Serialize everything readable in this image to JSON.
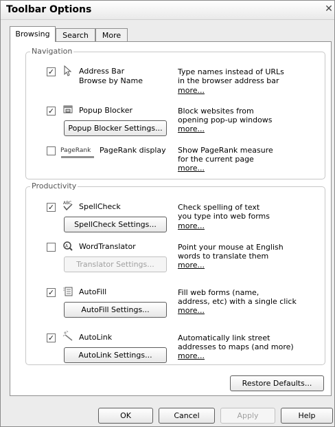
{
  "window": {
    "title": "Toolbar Options",
    "close_glyph": "✕"
  },
  "tabs": [
    {
      "label": "Browsing",
      "active": true
    },
    {
      "label": "Search",
      "active": false
    },
    {
      "label": "More",
      "active": false
    }
  ],
  "navigation": {
    "legend": "Navigation",
    "items": [
      {
        "label_line1": "Address Bar",
        "label_line2": "Browse by Name",
        "checked": true,
        "icon": "cursor-icon",
        "desc_line1": "Type names instead of URLs",
        "desc_line2": "in the browser address bar",
        "more": "more..."
      },
      {
        "label": "Popup Blocker",
        "checked": true,
        "icon": "popup-window-icon",
        "button": "Popup Blocker Settings...",
        "desc_line1": "Block websites from",
        "desc_line2": "opening pop-up windows",
        "more": "more..."
      },
      {
        "logo": "PageRank",
        "label": "PageRank display",
        "checked": false,
        "desc_line1": "Show PageRank measure",
        "desc_line2": "for the current page",
        "more": "more..."
      }
    ]
  },
  "productivity": {
    "legend": "Productivity",
    "items": [
      {
        "label": "SpellCheck",
        "checked": true,
        "icon": "spellcheck-icon",
        "button": "SpellCheck Settings...",
        "button_enabled": true,
        "desc_line1": "Check spelling of text",
        "desc_line2": "you type into web forms",
        "more": "more..."
      },
      {
        "label": "WordTranslator",
        "checked": false,
        "icon": "translator-icon",
        "button": "Translator Settings...",
        "button_enabled": false,
        "desc_line1": "Point your mouse at English",
        "desc_line2": "words to translate them",
        "more": "more..."
      },
      {
        "label": "AutoFill",
        "checked": true,
        "icon": "autofill-icon",
        "button": "AutoFill Settings...",
        "button_enabled": true,
        "desc_line1": "Fill web forms (name,",
        "desc_line2": "address, etc) with a single click",
        "more": "more..."
      },
      {
        "label": "AutoLink",
        "checked": true,
        "icon": "autolink-icon",
        "button": "AutoLink Settings...",
        "button_enabled": true,
        "desc_line1": "Automatically link street",
        "desc_line2": "addresses to maps (and more)",
        "more": "more..."
      }
    ]
  },
  "restore_defaults": "Restore Defaults...",
  "footer": {
    "ok": "OK",
    "cancel": "Cancel",
    "apply": "Apply",
    "help": "Help"
  },
  "check_glyph": "✓"
}
